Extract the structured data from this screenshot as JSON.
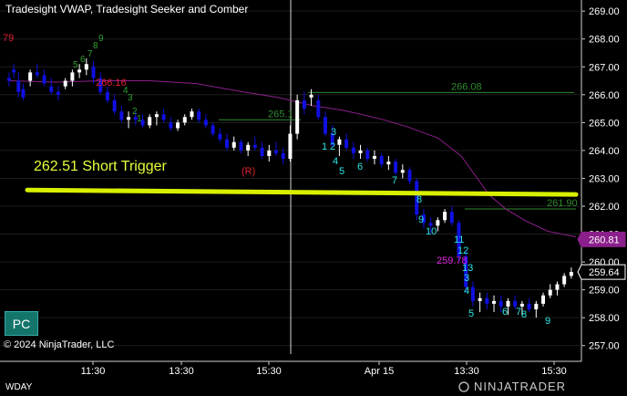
{
  "title": "Tradesight VWAP, Tradesight Seeker and Comber",
  "copyright": "© 2024 NinjaTrader, LLC",
  "instrument_tab": "WDAY",
  "button_label": "PC",
  "logo": "NINJATRADER",
  "colors": {
    "background": "#000000",
    "trigger_line": "#d8f000",
    "vwap": "#8b1f8b",
    "level_line": "#2f8a2f",
    "up_candle": "#ffffff",
    "down_candle": "#1010e0",
    "seeker_text": "#2ee6e6",
    "comber_text": "#2fa02f",
    "red_text": "#e0202e"
  },
  "chart_data": {
    "type": "candlestick",
    "xlabel": "",
    "ylabel": "",
    "ylim": [
      256.5,
      269.3
    ],
    "grid": true,
    "x_ticks": [
      "11:30",
      "13:30",
      "15:30",
      "Apr 15",
      "13:30",
      "15:30"
    ],
    "y_ticks": [
      "269.00",
      "268.00",
      "267.00",
      "266.00",
      "265.00",
      "264.00",
      "263.00",
      "262.00",
      "261.00",
      "260.00",
      "259.00",
      "258.00",
      "257.00"
    ],
    "session_break": "Apr 15",
    "price_badges": [
      {
        "text": "260.81",
        "value": 260.81,
        "color": "#8b1f8b"
      },
      {
        "text": "259.64",
        "value": 259.64,
        "color": "#ffffff"
      }
    ],
    "horizontal_levels": [
      {
        "label": "266.08",
        "value": 266.08
      },
      {
        "label": "265.1",
        "value": 265.1
      },
      {
        "label": "261.90",
        "value": 261.9
      }
    ],
    "trigger": {
      "label": "262.51 Short Trigger",
      "start_value": 262.58,
      "end_value": 262.42
    },
    "red_annotations": [
      {
        "text": "79",
        "value": 268.1
      },
      {
        "text": "266.16",
        "value": 266.3
      },
      {
        "text": "(R)",
        "value": 262.98
      },
      {
        "text": "259.78",
        "value": 259.7
      }
    ],
    "seeker_counts_day2_first": [
      "1",
      "2",
      "3",
      "4",
      "5",
      "6",
      "7",
      "8",
      "9",
      "10",
      "11",
      "12",
      "13"
    ],
    "seeker_counts_day2_second": [
      "3",
      "4",
      "5",
      "6",
      "7",
      "8",
      "9"
    ],
    "comber_counts_sample": [
      "9",
      "8",
      "7",
      "6",
      "5",
      "4",
      "3",
      "2",
      "1"
    ],
    "vwap": [
      [
        0,
        266.5
      ],
      [
        20,
        266.45
      ],
      [
        40,
        266.5
      ],
      [
        60,
        266.5
      ],
      [
        80,
        266.4
      ],
      [
        100,
        266.1
      ],
      [
        115,
        265.9
      ],
      [
        130,
        265.6
      ],
      [
        142,
        265.45
      ],
      [
        150,
        265.3
      ],
      [
        160,
        265.1
      ],
      [
        170,
        264.85
      ],
      [
        183,
        264.45
      ],
      [
        193,
        263.8
      ],
      [
        199,
        263.1
      ],
      [
        205,
        262.4
      ],
      [
        212,
        261.9
      ],
      [
        220,
        261.5
      ],
      [
        230,
        261.1
      ],
      [
        242,
        260.9
      ]
    ],
    "candles": [
      [
        0,
        266.6,
        266.8,
        266.3,
        266.5
      ],
      [
        2,
        266.9,
        267.1,
        266.6,
        266.8
      ],
      [
        4,
        266.5,
        266.8,
        265.9,
        266.1
      ],
      [
        6,
        266.2,
        266.4,
        265.8,
        265.9
      ],
      [
        9,
        266.5,
        266.9,
        266.3,
        266.8
      ],
      [
        12,
        266.8,
        267.1,
        266.6,
        266.7
      ],
      [
        15,
        266.7,
        266.9,
        266.3,
        266.4
      ],
      [
        18,
        266.3,
        266.6,
        266.0,
        266.1
      ],
      [
        21,
        266.1,
        266.3,
        265.8,
        266.0
      ],
      [
        24,
        266.3,
        266.6,
        266.2,
        266.5
      ],
      [
        27,
        266.5,
        266.9,
        266.3,
        266.8
      ],
      [
        30,
        266.8,
        267.1,
        266.6,
        266.9
      ],
      [
        33,
        266.9,
        267.3,
        266.7,
        267.1
      ],
      [
        36,
        267.0,
        267.2,
        266.4,
        266.6
      ],
      [
        39,
        266.6,
        266.8,
        266.0,
        266.1
      ],
      [
        42,
        266.1,
        266.3,
        265.7,
        265.8
      ],
      [
        45,
        265.8,
        266.0,
        265.3,
        265.4
      ],
      [
        48,
        265.4,
        265.6,
        265.0,
        265.1
      ],
      [
        51,
        265.1,
        265.4,
        264.8,
        265.2
      ],
      [
        54,
        265.2,
        265.4,
        264.9,
        265.1
      ],
      [
        57,
        265.1,
        265.3,
        264.8,
        264.9
      ],
      [
        60,
        264.9,
        265.3,
        264.8,
        265.2
      ],
      [
        63,
        265.2,
        265.4,
        264.9,
        265.3
      ],
      [
        66,
        265.3,
        265.5,
        265.0,
        265.1
      ],
      [
        69,
        265.0,
        265.2,
        264.7,
        264.8
      ],
      [
        72,
        264.8,
        265.1,
        264.7,
        265.0
      ],
      [
        75,
        265.0,
        265.3,
        264.9,
        265.2
      ],
      [
        78,
        265.2,
        265.5,
        265.1,
        265.4
      ],
      [
        81,
        265.4,
        265.5,
        265.0,
        265.1
      ],
      [
        84,
        265.1,
        265.3,
        264.8,
        264.9
      ],
      [
        87,
        264.9,
        265.0,
        264.5,
        264.6
      ],
      [
        90,
        264.6,
        264.8,
        264.3,
        264.4
      ],
      [
        93,
        264.4,
        264.6,
        264.0,
        264.1
      ],
      [
        96,
        264.1,
        264.5,
        264.0,
        264.3
      ],
      [
        99,
        264.3,
        264.4,
        263.9,
        264.0
      ],
      [
        102,
        264.0,
        264.3,
        263.8,
        264.2
      ],
      [
        105,
        264.2,
        264.5,
        264.0,
        264.1
      ],
      [
        108,
        264.1,
        264.3,
        263.7,
        263.8
      ],
      [
        111,
        263.8,
        264.2,
        263.6,
        264.0
      ],
      [
        114,
        264.0,
        264.3,
        263.8,
        263.9
      ],
      [
        117,
        263.9,
        264.1,
        263.5,
        263.7
      ],
      [
        120,
        263.7,
        264.9,
        263.6,
        264.6
      ],
      [
        123,
        264.6,
        266.0,
        264.4,
        265.8
      ],
      [
        126,
        265.8,
        266.1,
        265.3,
        265.5
      ],
      [
        129,
        265.9,
        266.2,
        265.6,
        266.0
      ],
      [
        132,
        265.8,
        266.0,
        265.1,
        265.2
      ],
      [
        135,
        265.2,
        265.4,
        264.5,
        264.6
      ],
      [
        138,
        264.6,
        264.9,
        264.1,
        264.2
      ],
      [
        141,
        264.2,
        264.5,
        263.8,
        264.4
      ],
      [
        144,
        264.4,
        264.6,
        264.0,
        264.1
      ],
      [
        147,
        264.1,
        264.3,
        263.7,
        263.9
      ],
      [
        150,
        263.9,
        264.2,
        263.7,
        264.0
      ],
      [
        153,
        264.0,
        264.1,
        263.6,
        263.7
      ],
      [
        156,
        263.7,
        264.0,
        263.5,
        263.8
      ],
      [
        159,
        263.8,
        263.9,
        263.4,
        263.5
      ],
      [
        162,
        263.5,
        263.8,
        263.3,
        263.6
      ],
      [
        165,
        263.6,
        263.7,
        263.1,
        263.2
      ],
      [
        168,
        263.2,
        263.5,
        263.0,
        263.3
      ],
      [
        171,
        263.3,
        263.4,
        262.8,
        262.9
      ],
      [
        174,
        262.9,
        263.0,
        261.5,
        261.7
      ],
      [
        177,
        261.7,
        261.9,
        261.2,
        261.4
      ],
      [
        180,
        261.4,
        261.6,
        261.0,
        261.3
      ],
      [
        183,
        261.3,
        261.6,
        261.1,
        261.5
      ],
      [
        186,
        261.5,
        261.9,
        261.4,
        261.8
      ],
      [
        189,
        261.8,
        262.0,
        261.3,
        261.4
      ],
      [
        192,
        261.4,
        261.5,
        260.0,
        260.2
      ],
      [
        195,
        260.2,
        260.4,
        258.9,
        259.1
      ],
      [
        198,
        259.1,
        259.3,
        258.4,
        258.6
      ],
      [
        201,
        258.6,
        258.9,
        258.2,
        258.7
      ],
      [
        204,
        258.7,
        258.9,
        258.3,
        258.5
      ],
      [
        207,
        258.5,
        258.8,
        258.2,
        258.6
      ],
      [
        210,
        258.6,
        258.8,
        258.2,
        258.4
      ],
      [
        213,
        258.4,
        258.7,
        258.1,
        258.6
      ],
      [
        216,
        258.6,
        258.8,
        258.3,
        258.4
      ],
      [
        219,
        258.4,
        258.6,
        258.1,
        258.5
      ],
      [
        222,
        258.5,
        258.7,
        258.2,
        258.3
      ],
      [
        225,
        258.3,
        258.6,
        258.0,
        258.5
      ],
      [
        228,
        258.5,
        258.9,
        258.4,
        258.8
      ],
      [
        231,
        258.8,
        259.2,
        258.7,
        259.0
      ],
      [
        234,
        259.0,
        259.3,
        258.8,
        259.2
      ],
      [
        237,
        259.2,
        259.6,
        259.1,
        259.5
      ],
      [
        240,
        259.5,
        259.8,
        259.4,
        259.64
      ]
    ]
  }
}
